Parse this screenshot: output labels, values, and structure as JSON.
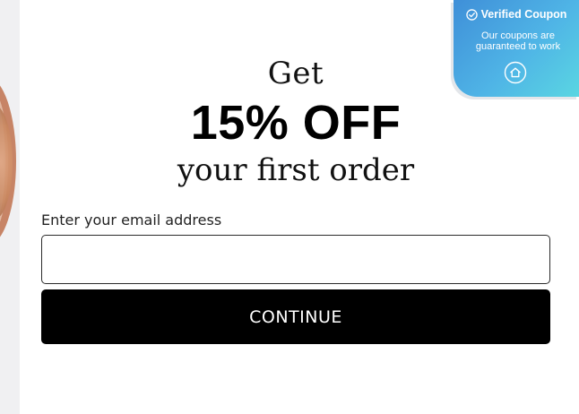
{
  "popup": {
    "heading_top": "Get",
    "heading_offer": "15% OFF",
    "heading_bottom": "your first order",
    "email_label": "Enter your email address",
    "email_value": "",
    "email_placeholder": "",
    "continue_label": "CONTINUE"
  },
  "badge": {
    "title": "Verified Coupon",
    "description": "Our coupons are guaranteed to work",
    "icons": [
      "check-circle-icon",
      "home-icon"
    ]
  },
  "colors": {
    "button_bg": "#000000",
    "badge_gradient_start": "#3f8fd8",
    "badge_gradient_end": "#5ad6e2"
  }
}
